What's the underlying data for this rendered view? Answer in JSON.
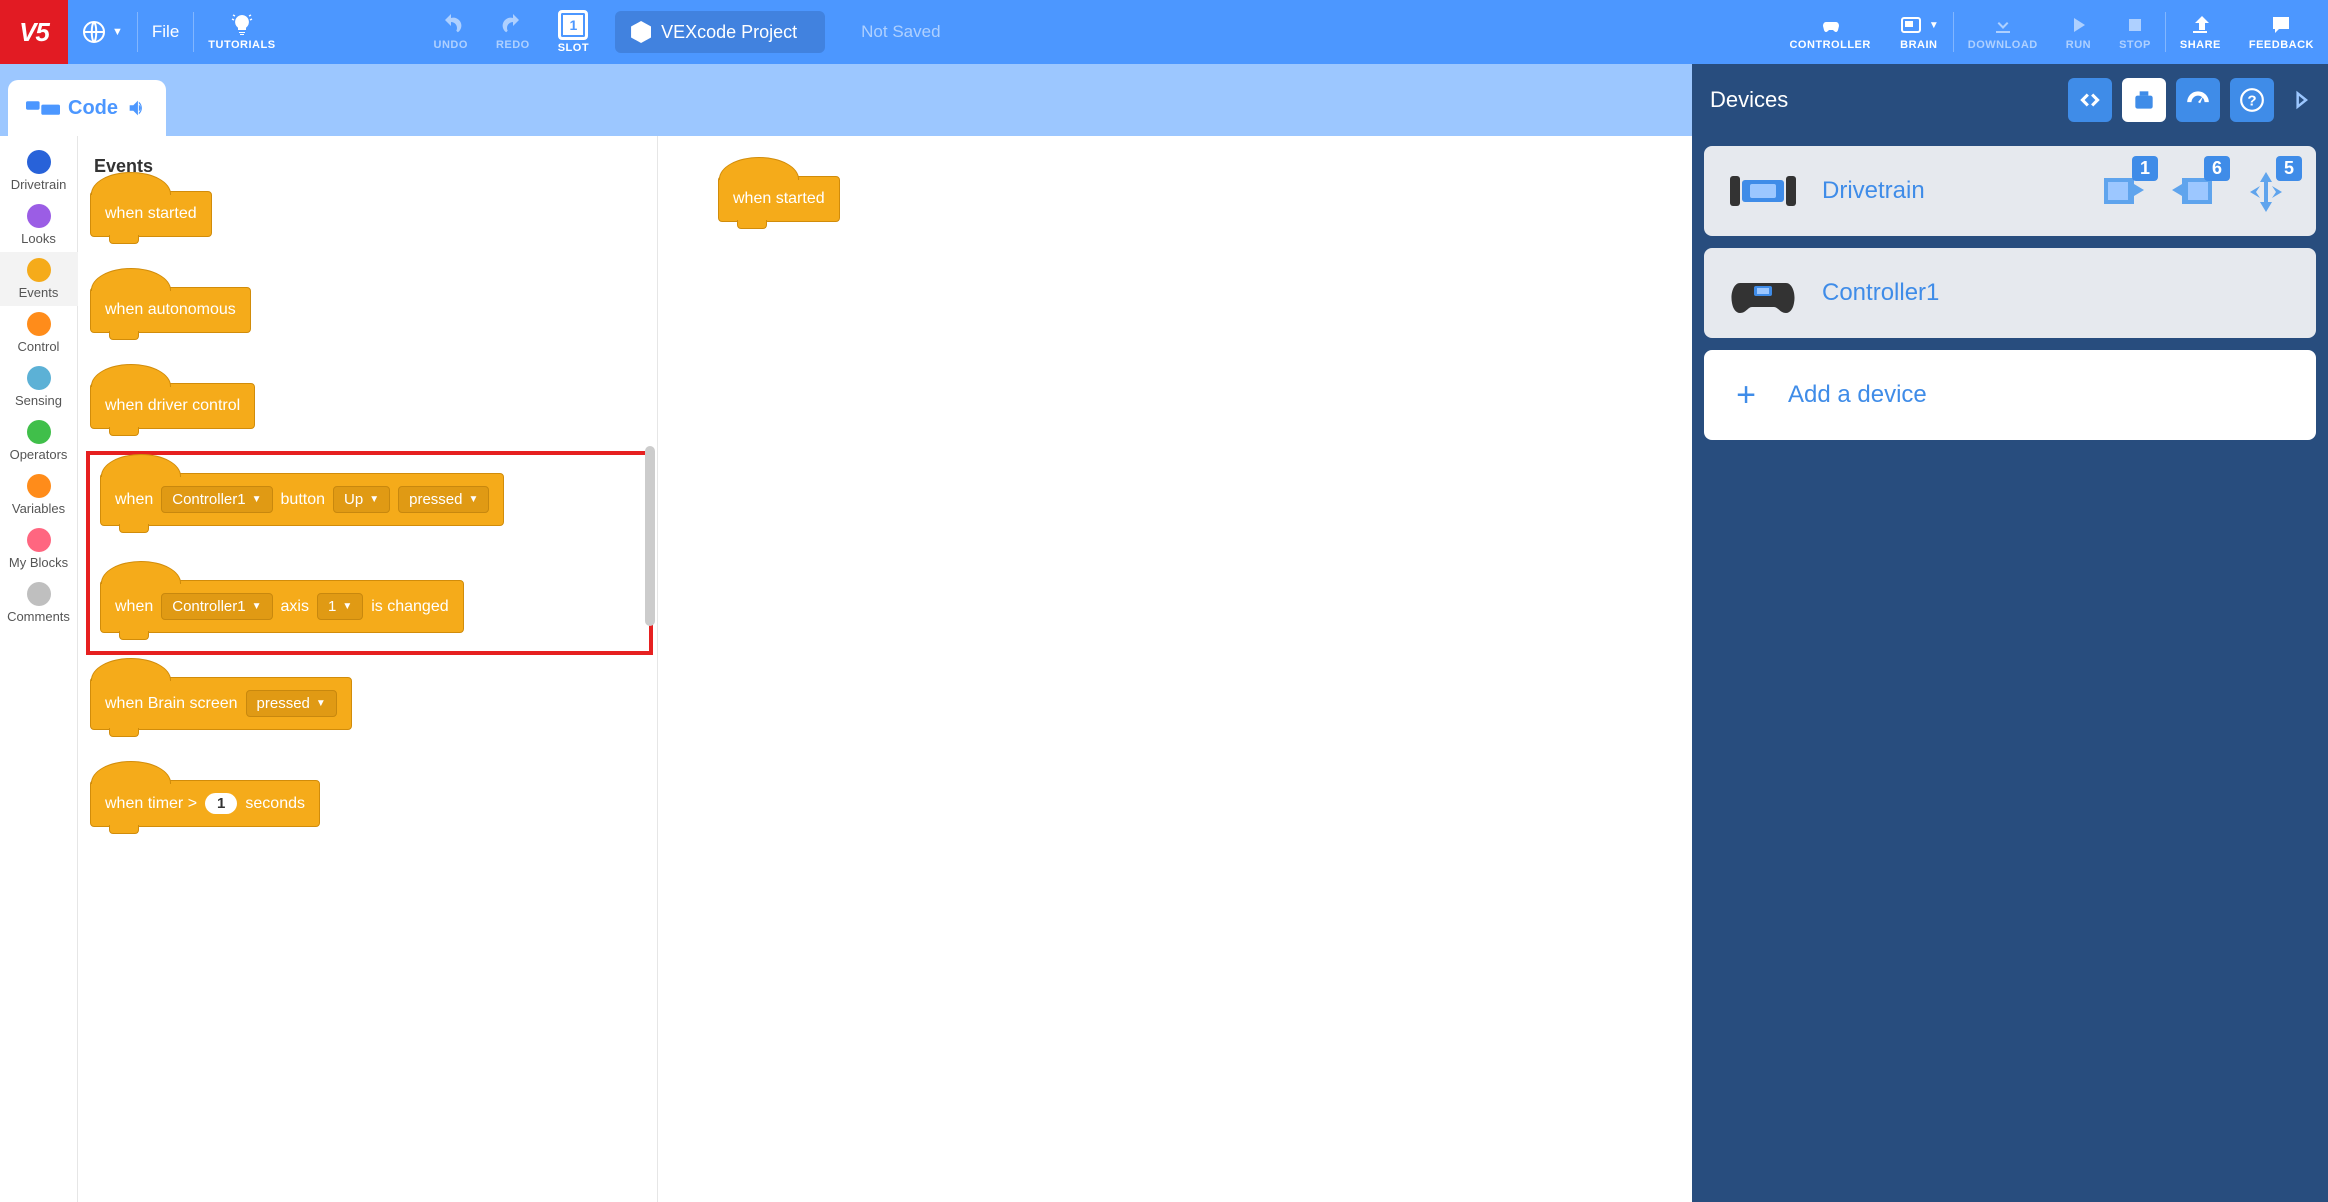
{
  "toolbar": {
    "logo": "V5",
    "file_label": "File",
    "tutorials_label": "TUTORIALS",
    "undo_label": "UNDO",
    "redo_label": "REDO",
    "slot_label": "SLOT",
    "slot_number": "1",
    "project_name": "VEXcode Project",
    "status": "Not Saved",
    "controller_label": "CONTROLLER",
    "brain_label": "BRAIN",
    "download_label": "DOWNLOAD",
    "run_label": "RUN",
    "stop_label": "STOP",
    "share_label": "SHARE",
    "feedback_label": "FEEDBACK"
  },
  "subheader": {
    "code_tab": "Code"
  },
  "categories": [
    {
      "name": "Drivetrain",
      "color": "#2862D9"
    },
    {
      "name": "Looks",
      "color": "#9B5DE5"
    },
    {
      "name": "Events",
      "color": "#F5AB1A"
    },
    {
      "name": "Control",
      "color": "#FF8C1A"
    },
    {
      "name": "Sensing",
      "color": "#5CB1D6"
    },
    {
      "name": "Operators",
      "color": "#40BF4A"
    },
    {
      "name": "Variables",
      "color": "#FF8C1A"
    },
    {
      "name": "My Blocks",
      "color": "#FF6680"
    },
    {
      "name": "Comments",
      "color": "#BFBFBF"
    }
  ],
  "active_category": "Events",
  "palette": {
    "header": "Events",
    "blocks": {
      "when_started": "when started",
      "when_autonomous": "when autonomous",
      "when_driver_control": "when driver control",
      "ctrl_btn": {
        "prefix": "when",
        "ctrl": "Controller1",
        "word_button": "button",
        "btn": "Up",
        "state": "pressed"
      },
      "ctrl_axis": {
        "prefix": "when",
        "ctrl": "Controller1",
        "word_axis": "axis",
        "axis": "1",
        "suffix": "is changed"
      },
      "brain_screen": {
        "prefix": "when Brain screen",
        "state": "pressed"
      },
      "timer": {
        "prefix": "when timer >",
        "value": "1",
        "suffix": "seconds"
      }
    }
  },
  "canvas": {
    "block_label": "when started"
  },
  "devices": {
    "title": "Devices",
    "drivetrain": {
      "label": "Drivetrain",
      "port1": "1",
      "port2": "6",
      "port3": "5"
    },
    "controller1": {
      "label": "Controller1"
    },
    "add_device": "Add a device"
  }
}
